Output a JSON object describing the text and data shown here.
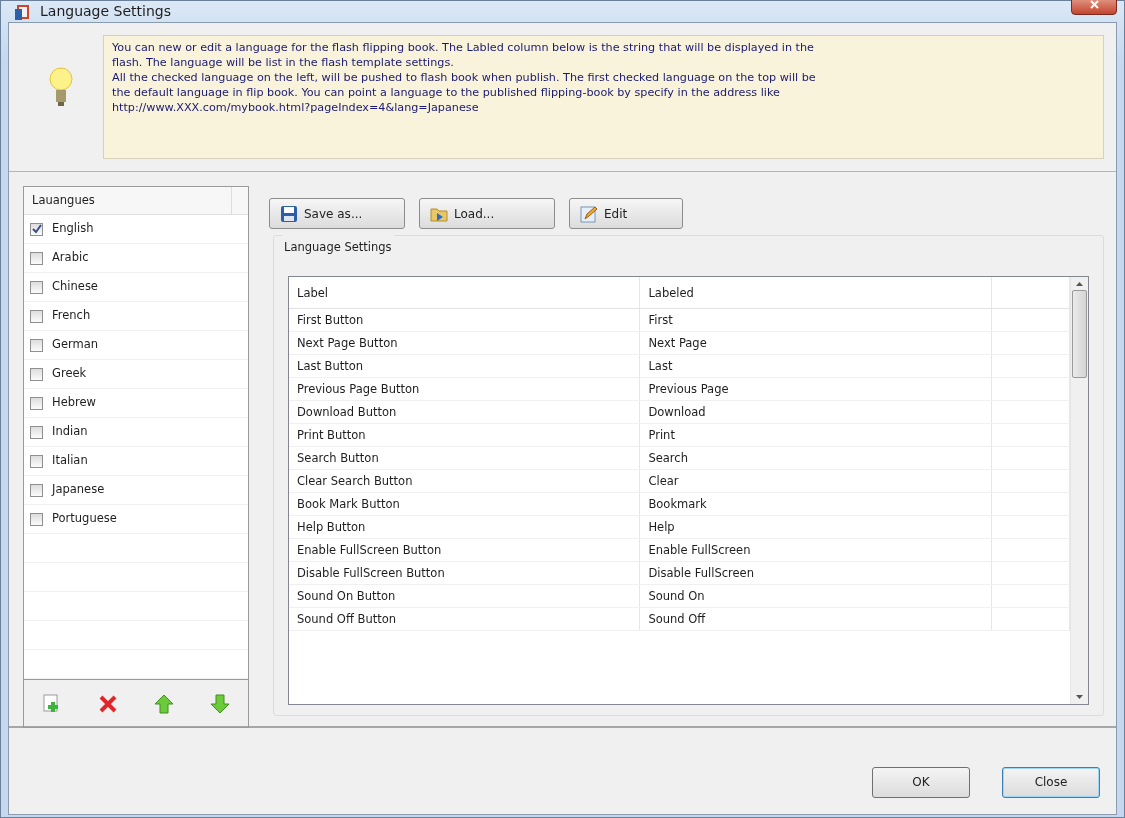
{
  "window": {
    "title": "Language Settings"
  },
  "info": {
    "lines": [
      "You can new or edit a language for the flash flipping book. The Labled column below is the string that will be displayed in the",
      "flash.  The language will be list in the flash template settings.",
      "All the checked language on the left, will be pushed to flash book when publish. The first checked language on the top will be",
      "the default language in flip book. You can point a language to the published flipping-book by  specify in the address like",
      "http://www.XXX.com/mybook.html?pageIndex=4&lang=Japanese"
    ]
  },
  "languages": {
    "header": "Lauangues",
    "items": [
      {
        "label": "English",
        "checked": true
      },
      {
        "label": "Arabic",
        "checked": false
      },
      {
        "label": "Chinese",
        "checked": false
      },
      {
        "label": "French",
        "checked": false
      },
      {
        "label": "German",
        "checked": false
      },
      {
        "label": "Greek",
        "checked": false
      },
      {
        "label": "Hebrew",
        "checked": false
      },
      {
        "label": "Indian",
        "checked": false
      },
      {
        "label": "Italian",
        "checked": false
      },
      {
        "label": "Japanese",
        "checked": false
      },
      {
        "label": "Portuguese",
        "checked": false
      }
    ],
    "tools": [
      {
        "kind": "add"
      },
      {
        "kind": "delete"
      },
      {
        "kind": "up"
      },
      {
        "kind": "down"
      }
    ]
  },
  "toolbar": [
    {
      "label": "Save as...",
      "kind": "save"
    },
    {
      "label": "Load...",
      "kind": "load"
    },
    {
      "label": "Edit",
      "kind": "edit"
    }
  ],
  "settings": {
    "title": "Language Settings",
    "columns": [
      "Label",
      "Labeled"
    ],
    "rows": [
      [
        "First Button",
        "First"
      ],
      [
        "Next Page Button",
        "Next Page"
      ],
      [
        "Last Button",
        "Last"
      ],
      [
        "Previous Page Button",
        "Previous Page"
      ],
      [
        "Download Button",
        "Download"
      ],
      [
        "Print Button",
        "Print"
      ],
      [
        "Search Button",
        "Search"
      ],
      [
        "Clear Search Button",
        "Clear"
      ],
      [
        "Book Mark Button",
        "Bookmark"
      ],
      [
        "Help Button",
        "Help"
      ],
      [
        "Enable FullScreen Button",
        "Enable FullScreen"
      ],
      [
        "Disable FullScreen Button",
        "Disable FullScreen"
      ],
      [
        "Sound On Button",
        "Sound On"
      ],
      [
        "Sound Off Button",
        "Sound Off"
      ]
    ]
  },
  "buttons": [
    "OK",
    "Close"
  ]
}
